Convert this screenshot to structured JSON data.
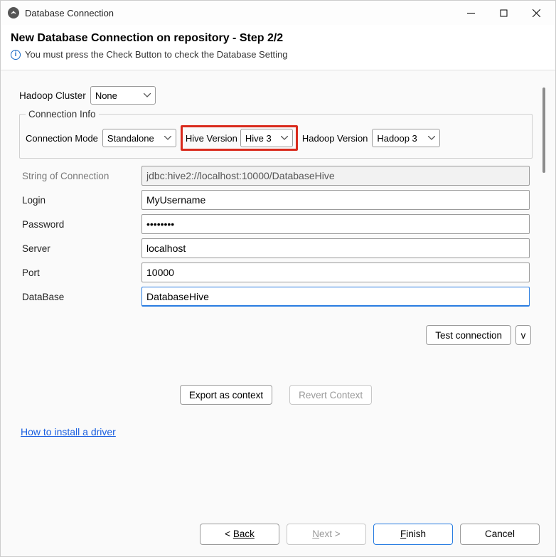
{
  "window": {
    "title": "Database Connection"
  },
  "header": {
    "title": "New Database Connection on repository - Step 2/2",
    "hint": "You must press the Check Button to check the Database Setting"
  },
  "hadoop_cluster": {
    "label": "Hadoop Cluster",
    "value": "None"
  },
  "connection_info": {
    "legend": "Connection Info",
    "mode_label": "Connection Mode",
    "mode_value": "Standalone",
    "hive_label": "Hive Version",
    "hive_value": "Hive 3",
    "hadoop_label": "Hadoop Version",
    "hadoop_value": "Hadoop 3"
  },
  "fields": {
    "connstr_label": "String of Connection",
    "connstr_value": "jdbc:hive2://localhost:10000/DatabaseHive",
    "login_label": "Login",
    "login_value": "MyUsername",
    "password_label": "Password",
    "password_value": "••••••••",
    "server_label": "Server",
    "server_value": "localhost",
    "port_label": "Port",
    "port_value": "10000",
    "database_label": "DataBase",
    "database_value": "DatabaseHive"
  },
  "actions": {
    "test": "Test connection",
    "v": "v",
    "export_ctx": "Export as context",
    "revert_ctx": "Revert Context"
  },
  "link": {
    "label": "How to install a driver"
  },
  "footer": {
    "back": "Back",
    "next": "Next >",
    "finish": "Finish",
    "cancel": "Cancel"
  }
}
